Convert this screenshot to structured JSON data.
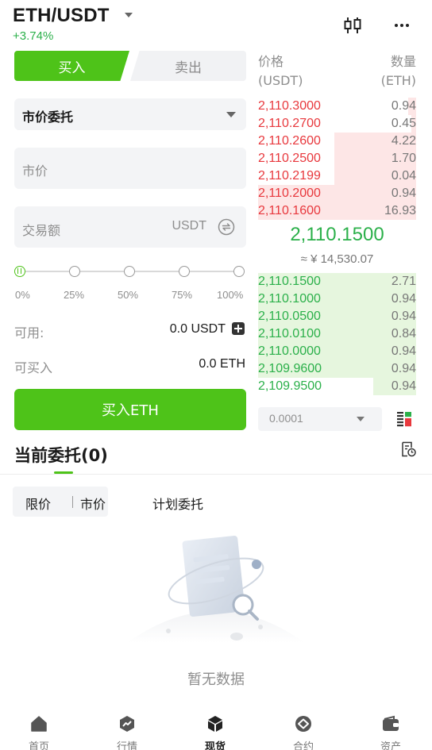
{
  "header": {
    "pair": "ETH/USDT",
    "change": "+3.74%"
  },
  "trade_tabs": {
    "buy": "买入",
    "sell": "卖出"
  },
  "form": {
    "order_type": "市价委托",
    "price_placeholder": "市价",
    "amount_placeholder": "交易额",
    "amount_unit": "USDT",
    "slider_percent": 0,
    "slider_labels": [
      "0%",
      "25%",
      "50%",
      "75%",
      "100%"
    ],
    "available_label": "可用:",
    "available_value": "0.0 USDT",
    "buyable_label": "可买入",
    "buyable_value": "0.0 ETH",
    "submit": "买入ETH"
  },
  "order_book": {
    "price_header": "价格",
    "price_unit": "(USDT)",
    "qty_header": "数量",
    "qty_unit": "(ETH)",
    "asks": [
      {
        "price": "2,110.3000",
        "qty": "0.94",
        "depth": 0.05
      },
      {
        "price": "2,110.2700",
        "qty": "0.45",
        "depth": 0.03
      },
      {
        "price": "2,110.2600",
        "qty": "4.22",
        "depth": 0.52
      },
      {
        "price": "2,110.2500",
        "qty": "1.70",
        "depth": 0.52
      },
      {
        "price": "2,110.2199",
        "qty": "0.04",
        "depth": 0.52
      },
      {
        "price": "2,110.2000",
        "qty": "0.94",
        "depth": 1.0
      },
      {
        "price": "2,110.1600",
        "qty": "16.93",
        "depth": 1.0
      }
    ],
    "last_price": "2,110.1500",
    "last_price_cny": "≈ ¥ 14,530.07",
    "bids": [
      {
        "price": "2,110.1500",
        "qty": "2.71",
        "depth": 1.0
      },
      {
        "price": "2,110.1000",
        "qty": "0.94",
        "depth": 1.0
      },
      {
        "price": "2,110.0500",
        "qty": "0.94",
        "depth": 1.0
      },
      {
        "price": "2,110.0100",
        "qty": "0.84",
        "depth": 1.0
      },
      {
        "price": "2,110.0000",
        "qty": "0.94",
        "depth": 1.0
      },
      {
        "price": "2,109.9600",
        "qty": "0.94",
        "depth": 1.0
      },
      {
        "price": "2,109.9500",
        "qty": "0.94",
        "depth": 0.27
      }
    ],
    "precision": "0.0001"
  },
  "orders": {
    "title": "当前委托(0)",
    "filter_limit": "限价",
    "filter_market": "市价",
    "plan_tab": "计划委托",
    "empty": "暂无数据"
  },
  "nav": {
    "items": [
      {
        "label": "首页",
        "icon": "home-icon"
      },
      {
        "label": "行情",
        "icon": "market-icon"
      },
      {
        "label": "现货",
        "icon": "spot-icon",
        "active": true
      },
      {
        "label": "合约",
        "icon": "contract-icon"
      },
      {
        "label": "资产",
        "icon": "wallet-icon"
      }
    ]
  },
  "colors": {
    "accent": "#4ec319",
    "up": "#2bb04a",
    "down": "#e8383d"
  }
}
